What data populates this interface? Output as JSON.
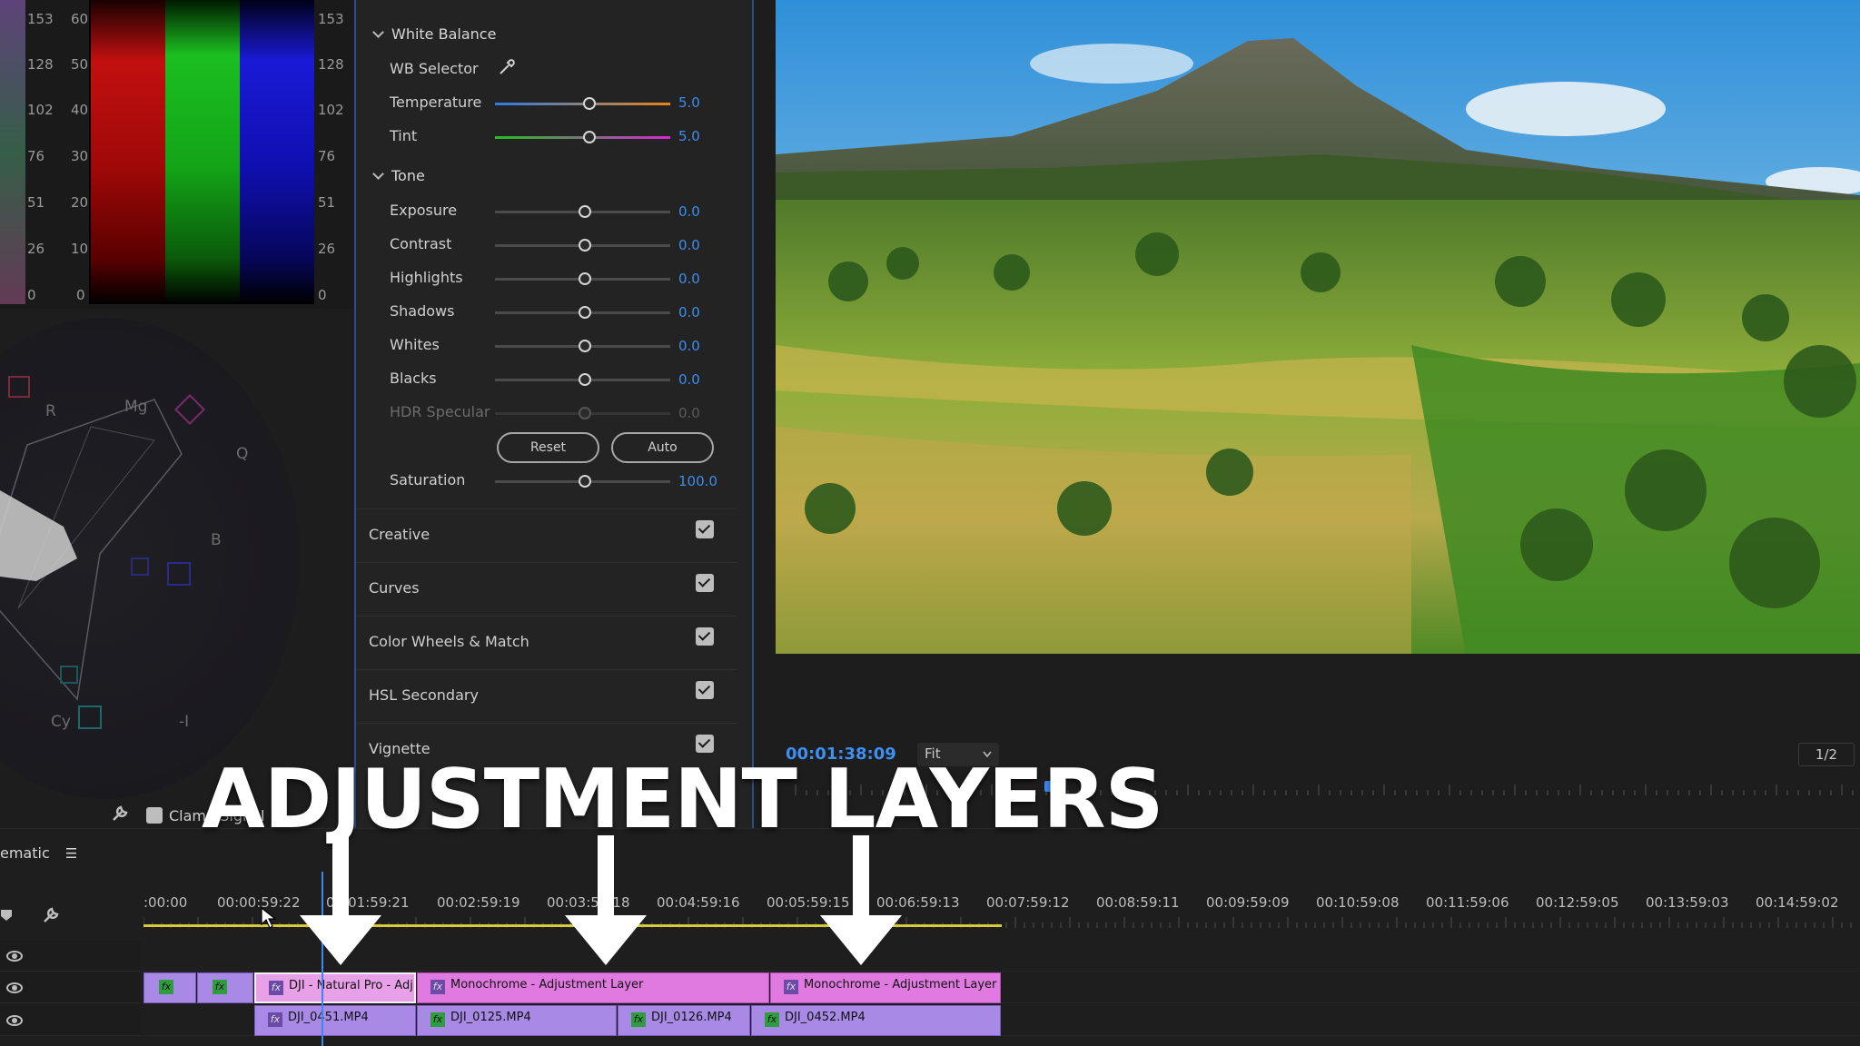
{
  "scopes": {
    "parade_scale_left_outer": [
      "153",
      "128",
      "102",
      "76",
      "51",
      "26",
      "0"
    ],
    "parade_scale_left_inner": [
      "60",
      "50",
      "40",
      "30",
      "20",
      "10",
      "0"
    ],
    "parade_scale_right": [
      "153",
      "128",
      "102",
      "76",
      "51",
      "26",
      "0"
    ],
    "vectorscope_labels": {
      "r": "R",
      "mg": "Mg",
      "q": "Q",
      "b": "B",
      "cy": "Cy",
      "i": "-I"
    },
    "clamp_label": "Clamp Signal"
  },
  "lumetri": {
    "white_balance": {
      "header": "White Balance",
      "wb_selector": "WB Selector",
      "temperature": {
        "label": "Temperature",
        "value": "5.0",
        "level": 0.54
      },
      "tint": {
        "label": "Tint",
        "value": "5.0",
        "level": 0.54
      }
    },
    "tone": {
      "header": "Tone",
      "rows": [
        {
          "label": "Exposure",
          "value": "0.0",
          "level": 0.5
        },
        {
          "label": "Contrast",
          "value": "0.0",
          "level": 0.5
        },
        {
          "label": "Highlights",
          "value": "0.0",
          "level": 0.5
        },
        {
          "label": "Shadows",
          "value": "0.0",
          "level": 0.5
        },
        {
          "label": "Whites",
          "value": "0.0",
          "level": 0.5
        },
        {
          "label": "Blacks",
          "value": "0.0",
          "level": 0.5
        },
        {
          "label": "HDR Specular",
          "value": "0.0",
          "level": 0.5
        }
      ],
      "reset_label": "Reset",
      "auto_label": "Auto",
      "saturation": {
        "label": "Saturation",
        "value": "100.0",
        "level": 0.5
      }
    },
    "sections": [
      {
        "label": "Creative",
        "checked": true
      },
      {
        "label": "Curves",
        "checked": true
      },
      {
        "label": "Color Wheels & Match",
        "checked": true
      },
      {
        "label": "HSL Secondary",
        "checked": true
      },
      {
        "label": "Vignette",
        "checked": true
      }
    ]
  },
  "monitor": {
    "timecode": "00:01:38:09",
    "fit_label": "Fit",
    "resolution": "1/2"
  },
  "timeline": {
    "sequence_name": "ematic",
    "timecodes": [
      ":00:00",
      "00:00:59:22",
      "00:01:59:21",
      "00:02:59:19",
      "00:03:59:18",
      "00:04:59:16",
      "00:05:59:15",
      "00:06:59:13",
      "00:07:59:12",
      "00:08:59:11",
      "00:09:59:09",
      "00:10:59:08",
      "00:11:59:06",
      "00:12:59:05",
      "00:13:59:03",
      "00:14:59:02"
    ],
    "adjustment_clips": [
      {
        "label": "DJI - Natural Pro - Adj"
      },
      {
        "label": "Monochrome - Adjustment Layer"
      },
      {
        "label": "Monochrome - Adjustment Layer"
      }
    ],
    "video_clips": [
      {
        "label": "DJI_0451.MP4"
      },
      {
        "label": "DJI_0125.MP4"
      },
      {
        "label": "DJI_0126.MP4"
      },
      {
        "label": "DJI_0452.MP4"
      }
    ]
  },
  "overlay": {
    "title": "ADJUSTMENT LAYERS"
  },
  "colors": {
    "accent_blue": "#3b8df0",
    "adjustment_clip": "#e07ae0",
    "video_clip": "#a88ae6",
    "work_area": "#d7c93a"
  }
}
